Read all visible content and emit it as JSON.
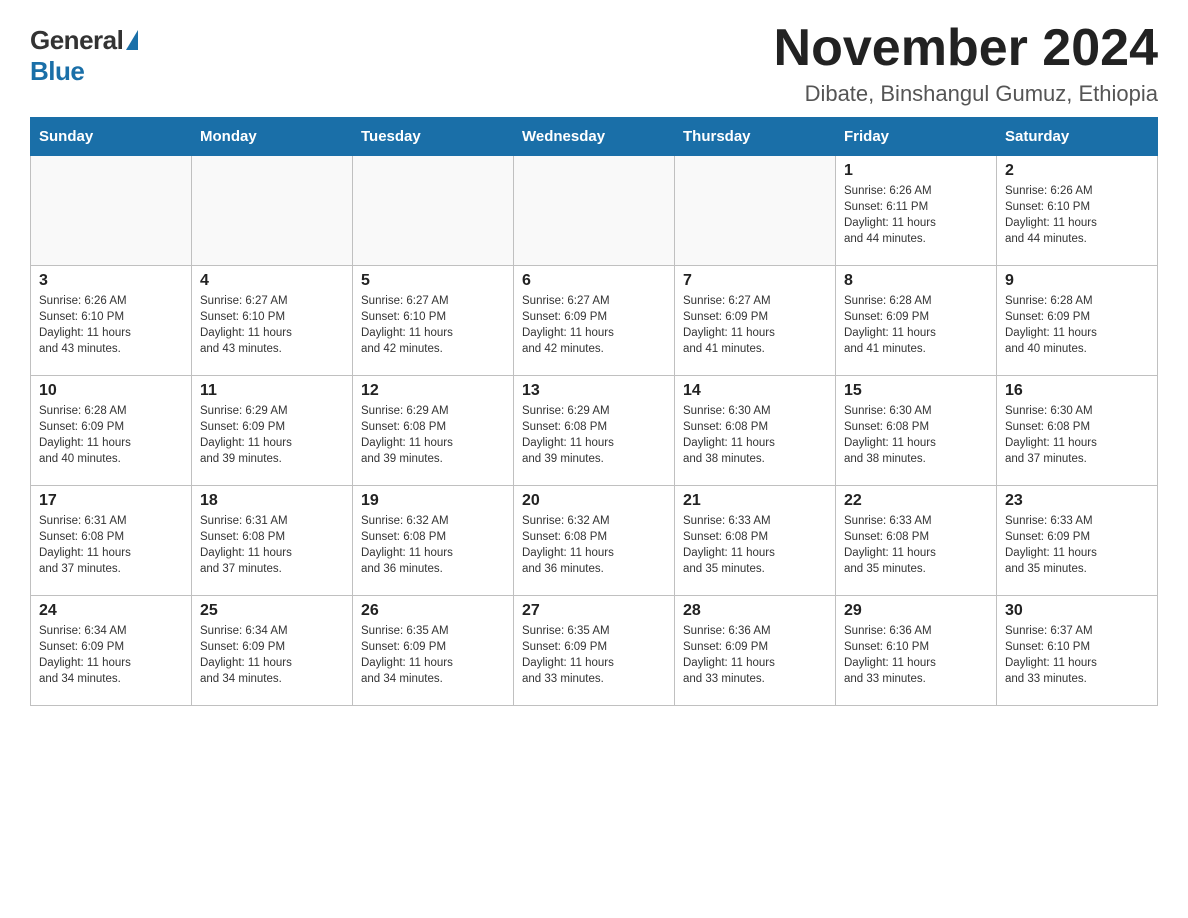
{
  "logo": {
    "general": "General",
    "blue": "Blue"
  },
  "title": "November 2024",
  "subtitle": "Dibate, Binshangul Gumuz, Ethiopia",
  "days_of_week": [
    "Sunday",
    "Monday",
    "Tuesday",
    "Wednesday",
    "Thursday",
    "Friday",
    "Saturday"
  ],
  "weeks": [
    [
      {
        "day": "",
        "info": ""
      },
      {
        "day": "",
        "info": ""
      },
      {
        "day": "",
        "info": ""
      },
      {
        "day": "",
        "info": ""
      },
      {
        "day": "",
        "info": ""
      },
      {
        "day": "1",
        "info": "Sunrise: 6:26 AM\nSunset: 6:11 PM\nDaylight: 11 hours\nand 44 minutes."
      },
      {
        "day": "2",
        "info": "Sunrise: 6:26 AM\nSunset: 6:10 PM\nDaylight: 11 hours\nand 44 minutes."
      }
    ],
    [
      {
        "day": "3",
        "info": "Sunrise: 6:26 AM\nSunset: 6:10 PM\nDaylight: 11 hours\nand 43 minutes."
      },
      {
        "day": "4",
        "info": "Sunrise: 6:27 AM\nSunset: 6:10 PM\nDaylight: 11 hours\nand 43 minutes."
      },
      {
        "day": "5",
        "info": "Sunrise: 6:27 AM\nSunset: 6:10 PM\nDaylight: 11 hours\nand 42 minutes."
      },
      {
        "day": "6",
        "info": "Sunrise: 6:27 AM\nSunset: 6:09 PM\nDaylight: 11 hours\nand 42 minutes."
      },
      {
        "day": "7",
        "info": "Sunrise: 6:27 AM\nSunset: 6:09 PM\nDaylight: 11 hours\nand 41 minutes."
      },
      {
        "day": "8",
        "info": "Sunrise: 6:28 AM\nSunset: 6:09 PM\nDaylight: 11 hours\nand 41 minutes."
      },
      {
        "day": "9",
        "info": "Sunrise: 6:28 AM\nSunset: 6:09 PM\nDaylight: 11 hours\nand 40 minutes."
      }
    ],
    [
      {
        "day": "10",
        "info": "Sunrise: 6:28 AM\nSunset: 6:09 PM\nDaylight: 11 hours\nand 40 minutes."
      },
      {
        "day": "11",
        "info": "Sunrise: 6:29 AM\nSunset: 6:09 PM\nDaylight: 11 hours\nand 39 minutes."
      },
      {
        "day": "12",
        "info": "Sunrise: 6:29 AM\nSunset: 6:08 PM\nDaylight: 11 hours\nand 39 minutes."
      },
      {
        "day": "13",
        "info": "Sunrise: 6:29 AM\nSunset: 6:08 PM\nDaylight: 11 hours\nand 39 minutes."
      },
      {
        "day": "14",
        "info": "Sunrise: 6:30 AM\nSunset: 6:08 PM\nDaylight: 11 hours\nand 38 minutes."
      },
      {
        "day": "15",
        "info": "Sunrise: 6:30 AM\nSunset: 6:08 PM\nDaylight: 11 hours\nand 38 minutes."
      },
      {
        "day": "16",
        "info": "Sunrise: 6:30 AM\nSunset: 6:08 PM\nDaylight: 11 hours\nand 37 minutes."
      }
    ],
    [
      {
        "day": "17",
        "info": "Sunrise: 6:31 AM\nSunset: 6:08 PM\nDaylight: 11 hours\nand 37 minutes."
      },
      {
        "day": "18",
        "info": "Sunrise: 6:31 AM\nSunset: 6:08 PM\nDaylight: 11 hours\nand 37 minutes."
      },
      {
        "day": "19",
        "info": "Sunrise: 6:32 AM\nSunset: 6:08 PM\nDaylight: 11 hours\nand 36 minutes."
      },
      {
        "day": "20",
        "info": "Sunrise: 6:32 AM\nSunset: 6:08 PM\nDaylight: 11 hours\nand 36 minutes."
      },
      {
        "day": "21",
        "info": "Sunrise: 6:33 AM\nSunset: 6:08 PM\nDaylight: 11 hours\nand 35 minutes."
      },
      {
        "day": "22",
        "info": "Sunrise: 6:33 AM\nSunset: 6:08 PM\nDaylight: 11 hours\nand 35 minutes."
      },
      {
        "day": "23",
        "info": "Sunrise: 6:33 AM\nSunset: 6:09 PM\nDaylight: 11 hours\nand 35 minutes."
      }
    ],
    [
      {
        "day": "24",
        "info": "Sunrise: 6:34 AM\nSunset: 6:09 PM\nDaylight: 11 hours\nand 34 minutes."
      },
      {
        "day": "25",
        "info": "Sunrise: 6:34 AM\nSunset: 6:09 PM\nDaylight: 11 hours\nand 34 minutes."
      },
      {
        "day": "26",
        "info": "Sunrise: 6:35 AM\nSunset: 6:09 PM\nDaylight: 11 hours\nand 34 minutes."
      },
      {
        "day": "27",
        "info": "Sunrise: 6:35 AM\nSunset: 6:09 PM\nDaylight: 11 hours\nand 33 minutes."
      },
      {
        "day": "28",
        "info": "Sunrise: 6:36 AM\nSunset: 6:09 PM\nDaylight: 11 hours\nand 33 minutes."
      },
      {
        "day": "29",
        "info": "Sunrise: 6:36 AM\nSunset: 6:10 PM\nDaylight: 11 hours\nand 33 minutes."
      },
      {
        "day": "30",
        "info": "Sunrise: 6:37 AM\nSunset: 6:10 PM\nDaylight: 11 hours\nand 33 minutes."
      }
    ]
  ]
}
